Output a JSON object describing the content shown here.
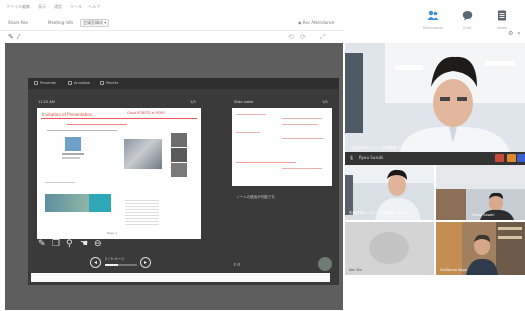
{
  "menubar": {
    "items": [
      "ファイル",
      "編集",
      "表示",
      "通話",
      "ツール",
      "ヘルプ"
    ]
  },
  "toolbar": {
    "left_button": "Share Res",
    "mid_button": "Meeting Info",
    "dropdown": "会議室構成 ▾",
    "status": "Rec Attendance"
  },
  "right_tools": [
    {
      "icon": "participants-icon",
      "glyph": "👥",
      "label": "Participants",
      "active": true
    },
    {
      "icon": "chat-icon",
      "glyph": "●",
      "label": "Chat",
      "active": false
    },
    {
      "icon": "notes-icon",
      "glyph": "▤",
      "label": "Notes",
      "active": false
    }
  ],
  "share": {
    "bar_items": [
      "Presenter",
      "Annotate",
      "Pointer"
    ],
    "left_header": "11:25 AM",
    "left_page": "1/3",
    "right_header": "Slide notes",
    "right_page": "1/3",
    "slide_title": "Invitation of Presentation",
    "slide_subtitle": "Cloud ROBOTS at ROBO",
    "slide_footer": "Page 1",
    "notes_placeholder": "ノートの追加が可能です。",
    "page_indicator": "2 / 5 ページ",
    "progress": 0.4
  },
  "videos": [
    {
      "name": "先端技術センター / 研究開発 (Hiro)",
      "role": "main"
    },
    {
      "name": "先端技術センター / 研究開発 (Hiro)",
      "role": "room"
    },
    {
      "name": "Yasuo Sasaki",
      "role": "tile"
    },
    {
      "name": "Ken Kin",
      "role": "tile"
    },
    {
      "name": "Guillermo Vega",
      "role": "tile"
    }
  ],
  "controls": {
    "name": "Ryuu Susuki"
  }
}
